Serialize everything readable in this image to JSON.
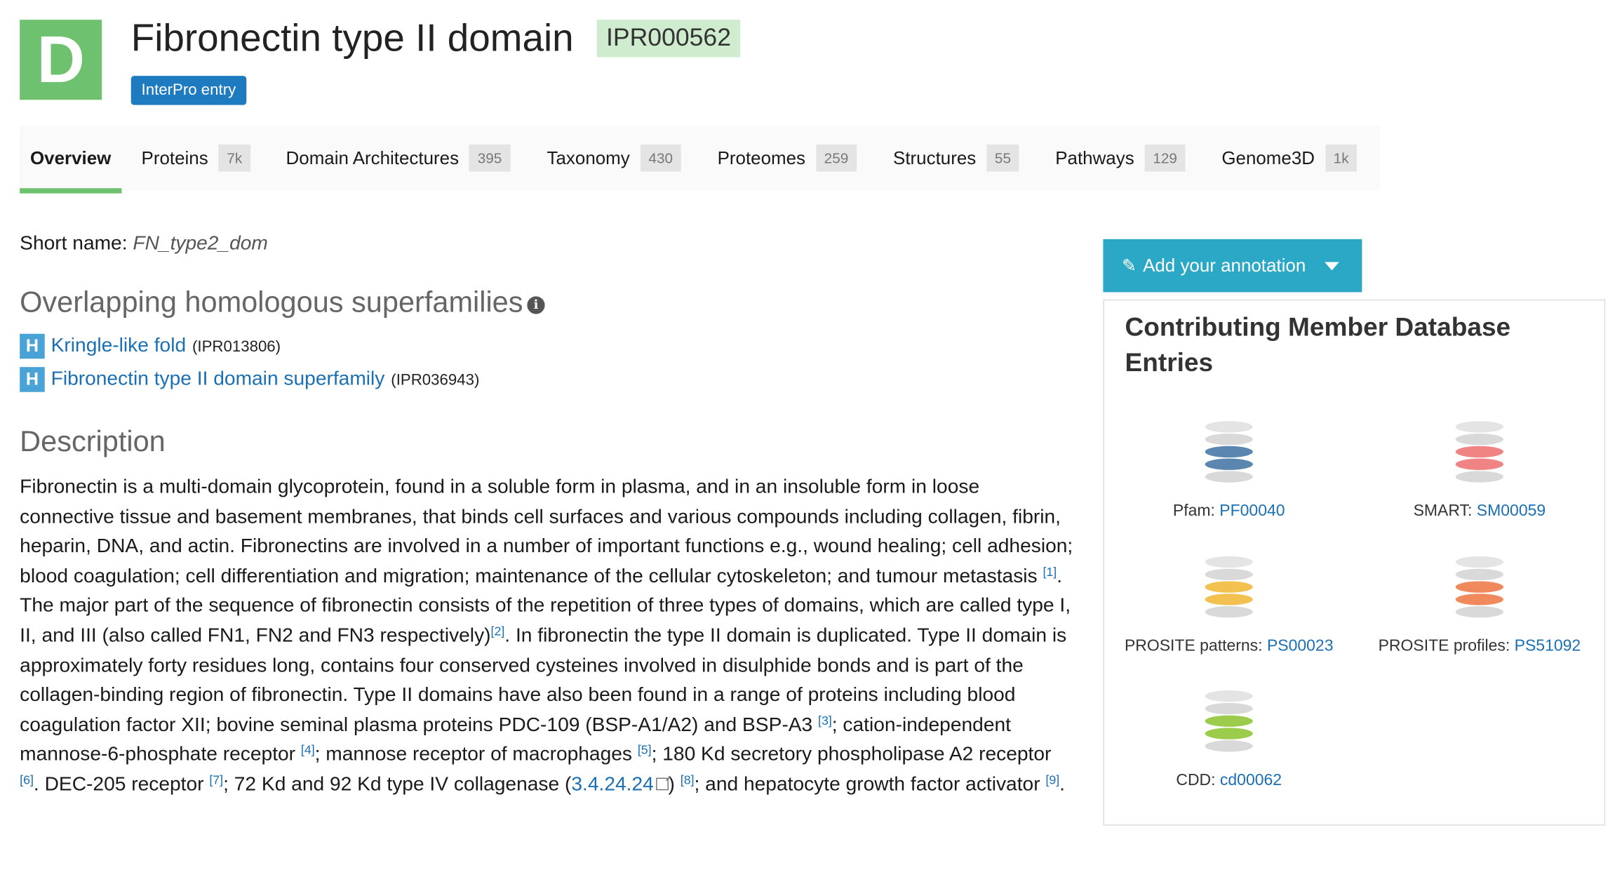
{
  "header": {
    "type_letter": "D",
    "title": "Fibronectin type II domain",
    "accession": "IPR000562",
    "entry_tag": "InterPro entry"
  },
  "tabs": [
    {
      "label": "Overview",
      "count": ""
    },
    {
      "label": "Proteins",
      "count": "7k"
    },
    {
      "label": "Domain Architectures",
      "count": "395"
    },
    {
      "label": "Taxonomy",
      "count": "430"
    },
    {
      "label": "Proteomes",
      "count": "259"
    },
    {
      "label": "Structures",
      "count": "55"
    },
    {
      "label": "Pathways",
      "count": "129"
    },
    {
      "label": "Genome3D",
      "count": "1k"
    }
  ],
  "short_name": {
    "label": "Short name:",
    "value": "FN_type2_dom"
  },
  "superfamilies": {
    "heading": "Overlapping homologous superfamilies",
    "items": [
      {
        "badge": "H",
        "name": "Kringle-like fold",
        "accession": "(IPR013806)"
      },
      {
        "badge": "H",
        "name": "Fibronectin type II domain superfamily",
        "accession": "(IPR036943)"
      }
    ]
  },
  "description": {
    "heading": "Description",
    "p1": "Fibronectin is a multi-domain glycoprotein, found in a soluble form in plasma, and in an insoluble form in loose connective tissue and basement membranes, that binds cell surfaces and various compounds including collagen, fibrin, heparin, DNA, and actin. Fibronectins are involved in a number of important functions e.g., wound healing; cell adhesion; blood coagulation; cell differentiation and migration; maintenance of the cellular cytoskeleton; and tumour metastasis",
    "p1_ref": "[1]",
    "p1_end": ".",
    "p2_a": "The major part of the sequence of fibronectin consists of the repetition of three types of domains, which are called type I, II, and III (also called FN1, FN2 and FN3 respectively)",
    "ref2": "[2]",
    "p2_b": ". In fibronectin the type II domain is duplicated. Type II domain is approximately forty residues long, contains four conserved cysteines involved in disulphide bonds and is part of the collagen-binding region of fibronectin. Type II domains have also been found in a range of proteins including blood coagulation factor XII; bovine seminal plasma proteins PDC-109 (BSP-A1/A2) and BSP-A3 ",
    "ref3": "[3]",
    "p2_c": "; cation-independent mannose-6-phosphate receptor ",
    "ref4": "[4]",
    "p2_d": "; mannose receptor of macrophages ",
    "ref5": "[5]",
    "p2_e": "; 180 Kd secretory phospholipase A2 receptor ",
    "ref6": "[6]",
    "p2_f": ". DEC-205 receptor ",
    "ref7": "[7]",
    "p2_g": "; 72 Kd and 92 Kd type IV collagenase (",
    "ec_link": "3.4.24.24",
    "p2_h": ") ",
    "ref8": "[8]",
    "p2_i": "; and hepatocyte growth factor activator ",
    "ref9": "[9]",
    "p2_j": "."
  },
  "sidebar": {
    "annotation_button": "Add your annotation",
    "panel_title": "Contributing Member Database Entries",
    "databases": [
      {
        "name": "Pfam:",
        "accession": "PF00040",
        "color": "#5b86b0"
      },
      {
        "name": "SMART:",
        "accession": "SM00059",
        "color": "#f08383"
      },
      {
        "name": "PROSITE patterns:",
        "accession": "PS00023",
        "color": "#f2c150"
      },
      {
        "name": "PROSITE profiles:",
        "accession": "PS51092",
        "color": "#f0895c"
      },
      {
        "name": "CDD:",
        "accession": "cd00062",
        "color": "#9ccc4c"
      }
    ]
  },
  "colors": {
    "entry_type": "#6ec16e",
    "link": "#1a6fb5",
    "annotation_button": "#2ba8c5",
    "superfamily_badge": "#4aa3d6"
  }
}
